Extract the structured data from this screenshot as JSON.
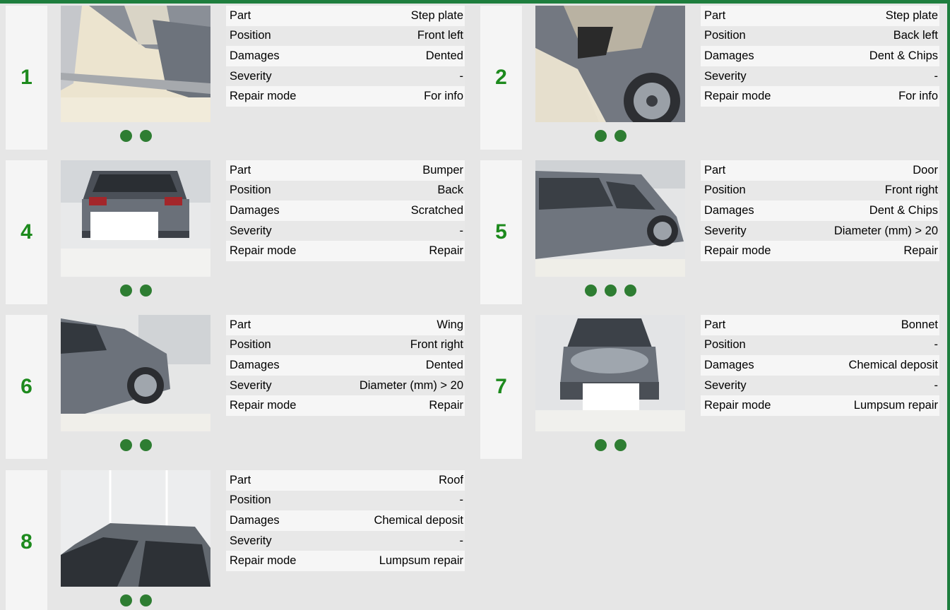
{
  "colors": {
    "accent": "#1e7e3e",
    "number": "#1d8a1d",
    "dot": "#2e7d32"
  },
  "cards": [
    {
      "number": "1",
      "dots": 2,
      "photo": "step-plate-front-left-photo",
      "rows": [
        {
          "key": "Part",
          "value": "Step plate"
        },
        {
          "key": "Position",
          "value": "Front left"
        },
        {
          "key": "Damages",
          "value": "Dented"
        },
        {
          "key": "Severity",
          "value": "-"
        },
        {
          "key": "Repair mode",
          "value": "For info"
        }
      ]
    },
    {
      "number": "2",
      "dots": 2,
      "photo": "step-plate-back-left-photo",
      "rows": [
        {
          "key": "Part",
          "value": "Step plate"
        },
        {
          "key": "Position",
          "value": "Back left"
        },
        {
          "key": "Damages",
          "value": "Dent & Chips"
        },
        {
          "key": "Severity",
          "value": "-"
        },
        {
          "key": "Repair mode",
          "value": "For info"
        }
      ]
    },
    {
      "number": "4",
      "dots": 2,
      "photo": "bumper-back-photo",
      "rows": [
        {
          "key": "Part",
          "value": "Bumper"
        },
        {
          "key": "Position",
          "value": "Back"
        },
        {
          "key": "Damages",
          "value": "Scratched"
        },
        {
          "key": "Severity",
          "value": "-"
        },
        {
          "key": "Repair mode",
          "value": "Repair"
        }
      ]
    },
    {
      "number": "5",
      "dots": 3,
      "photo": "door-front-right-photo",
      "rows": [
        {
          "key": "Part",
          "value": "Door"
        },
        {
          "key": "Position",
          "value": "Front right"
        },
        {
          "key": "Damages",
          "value": "Dent & Chips"
        },
        {
          "key": "Severity",
          "value": "Diameter (mm) > 20"
        },
        {
          "key": "Repair mode",
          "value": "Repair"
        }
      ]
    },
    {
      "number": "6",
      "dots": 2,
      "photo": "wing-front-right-photo",
      "rows": [
        {
          "key": "Part",
          "value": "Wing"
        },
        {
          "key": "Position",
          "value": "Front right"
        },
        {
          "key": "Damages",
          "value": "Dented"
        },
        {
          "key": "Severity",
          "value": "Diameter (mm) > 20"
        },
        {
          "key": "Repair mode",
          "value": "Repair"
        }
      ]
    },
    {
      "number": "7",
      "dots": 2,
      "photo": "bonnet-photo",
      "rows": [
        {
          "key": "Part",
          "value": "Bonnet"
        },
        {
          "key": "Position",
          "value": "-"
        },
        {
          "key": "Damages",
          "value": "Chemical deposit"
        },
        {
          "key": "Severity",
          "value": "-"
        },
        {
          "key": "Repair mode",
          "value": "Lumpsum repair"
        }
      ]
    },
    {
      "number": "8",
      "dots": 2,
      "photo": "roof-photo",
      "rows": [
        {
          "key": "Part",
          "value": "Roof"
        },
        {
          "key": "Position",
          "value": "-"
        },
        {
          "key": "Damages",
          "value": "Chemical deposit"
        },
        {
          "key": "Severity",
          "value": "-"
        },
        {
          "key": "Repair mode",
          "value": "Lumpsum repair"
        }
      ]
    }
  ]
}
